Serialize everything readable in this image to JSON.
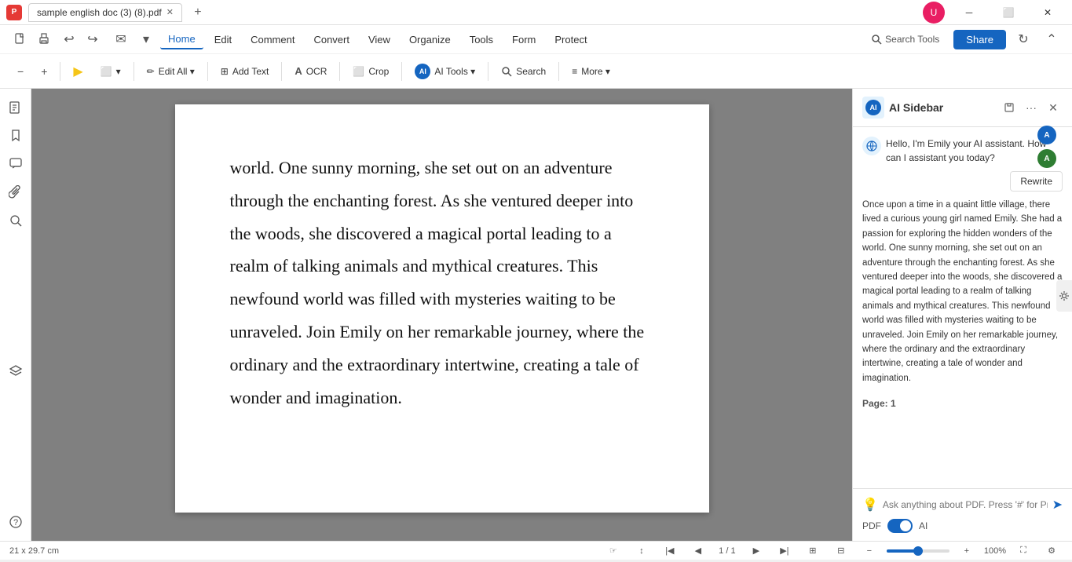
{
  "titlebar": {
    "tab_title": "sample english doc (3) (8).pdf",
    "new_tab_icon": "+",
    "app_icon_label": "P"
  },
  "menu": {
    "items": [
      {
        "id": "file",
        "label": "File"
      },
      {
        "id": "home",
        "label": "Home",
        "active": true
      },
      {
        "id": "edit",
        "label": "Edit"
      },
      {
        "id": "comment",
        "label": "Comment"
      },
      {
        "id": "convert",
        "label": "Convert"
      },
      {
        "id": "view",
        "label": "View"
      },
      {
        "id": "organize",
        "label": "Organize"
      },
      {
        "id": "tools",
        "label": "Tools"
      },
      {
        "id": "form",
        "label": "Form"
      },
      {
        "id": "protect",
        "label": "Protect"
      }
    ],
    "search_tools": "Search Tools",
    "share_label": "Share",
    "undo_icon": "↩",
    "redo_icon": "↪"
  },
  "toolbar": {
    "tools": [
      {
        "id": "zoom-out",
        "icon": "−",
        "label": ""
      },
      {
        "id": "zoom-in",
        "icon": "+",
        "label": ""
      },
      {
        "id": "highlight",
        "icon": "▶",
        "label": ""
      },
      {
        "id": "select",
        "icon": "⬜",
        "label": "▾"
      },
      {
        "id": "edit-all",
        "icon": "✏",
        "label": "Edit All ▾"
      },
      {
        "id": "add-text",
        "icon": "⊞",
        "label": "Add Text"
      },
      {
        "id": "ocr",
        "icon": "A",
        "label": "OCR"
      },
      {
        "id": "crop",
        "icon": "⬜",
        "label": "Crop"
      },
      {
        "id": "ai-tools",
        "icon": "AI",
        "label": "AI Tools ▾"
      },
      {
        "id": "search",
        "icon": "🔍",
        "label": "Search"
      },
      {
        "id": "more",
        "icon": "≡",
        "label": "More ▾"
      }
    ]
  },
  "sidebar_icons": [
    {
      "id": "pages",
      "icon": "☰",
      "title": "Pages"
    },
    {
      "id": "bookmark",
      "icon": "🔖",
      "title": "Bookmark"
    },
    {
      "id": "comment",
      "icon": "💬",
      "title": "Comments"
    },
    {
      "id": "attach",
      "icon": "📎",
      "title": "Attachments"
    },
    {
      "id": "search",
      "icon": "🔍",
      "title": "Search"
    },
    {
      "id": "layers",
      "icon": "⬛",
      "title": "Layers"
    }
  ],
  "pdf": {
    "text": "world. One sunny morning, she set out on an adventure through the enchanting forest. As she ventured deeper into the woods, she discovered a magical portal leading to a realm of talking animals and mythical creatures. This newfound world was filled with mysteries waiting to be unraveled. Join Emily on her remarkable journey, where the ordinary and the extraordinary intertwine, creating a tale of wonder and imagination."
  },
  "ai_sidebar": {
    "title": "AI Sidebar",
    "greeting": "Hello, I'm Emily your AI assistant. How can I assistant you today?",
    "rewrite_label": "Rewrite",
    "content": "Once upon a time in a quaint little village, there lived a curious young girl named Emily. She had a passion for exploring the hidden wonders of the world. One sunny morning, she set out on an adventure through the enchanting forest. As she ventured deeper into the woods, she discovered a magical portal leading to a realm of talking animals and mythical creatures. This newfound world was filled with mysteries waiting to be unraveled. Join Emily on her remarkable journey, where the ordinary and the extraordinary intertwine, creating a tale of wonder and imagination.",
    "page_label": "Page:",
    "page_number": "1",
    "input_placeholder": "Ask anything about PDF. Press '#' for Prompts.",
    "pdf_label": "PDF",
    "ai_label": "AI",
    "toggle_pdf": true,
    "toggle_ai": false
  },
  "statusbar": {
    "dimensions": "21 x 29.7 cm",
    "page_info": "1 / 1",
    "zoom_level": "100%"
  }
}
